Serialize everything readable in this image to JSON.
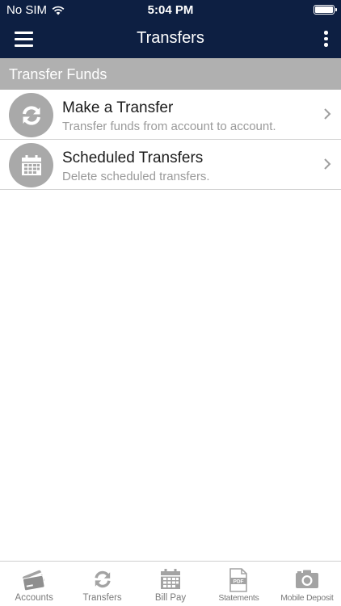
{
  "status": {
    "carrier": "No SIM",
    "time": "5:04 PM"
  },
  "nav": {
    "title": "Transfers"
  },
  "section": {
    "title": "Transfer Funds"
  },
  "items": [
    {
      "title": "Make a Transfer",
      "subtitle": "Transfer funds from account to account.",
      "icon": "transfer-icon"
    },
    {
      "title": "Scheduled Transfers",
      "subtitle": "Delete scheduled transfers.",
      "icon": "calendar-icon"
    }
  ],
  "tabs": [
    {
      "label": "Accounts",
      "icon": "card-icon"
    },
    {
      "label": "Transfers",
      "icon": "transfer-icon"
    },
    {
      "label": "Bill Pay",
      "icon": "calendar-icon"
    },
    {
      "label": "Statements",
      "icon": "pdf-icon"
    },
    {
      "label": "Mobile Deposit",
      "icon": "camera-icon"
    }
  ],
  "pdf_icon_text": "PDF",
  "colors": {
    "header": "#0d1f42",
    "section": "#b0b0b0",
    "icon_circle": "#a9a9a9",
    "tab_icon": "#a3a3a3"
  }
}
